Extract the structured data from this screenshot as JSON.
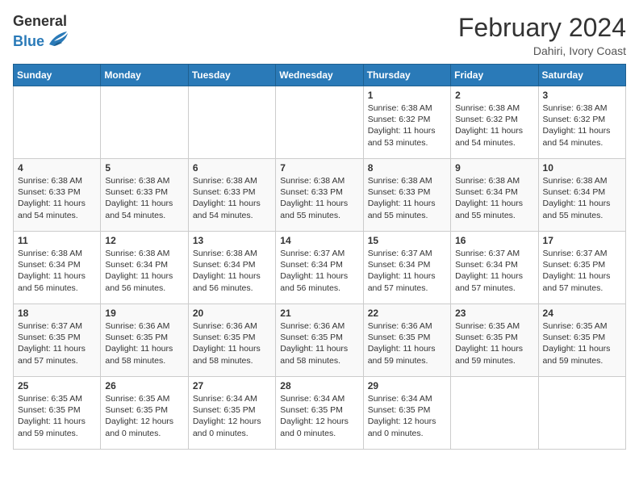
{
  "logo": {
    "general": "General",
    "blue": "Blue"
  },
  "header": {
    "month": "February 2024",
    "location": "Dahiri, Ivory Coast"
  },
  "weekdays": [
    "Sunday",
    "Monday",
    "Tuesday",
    "Wednesday",
    "Thursday",
    "Friday",
    "Saturday"
  ],
  "weeks": [
    [
      {
        "day": "",
        "info": ""
      },
      {
        "day": "",
        "info": ""
      },
      {
        "day": "",
        "info": ""
      },
      {
        "day": "",
        "info": ""
      },
      {
        "day": "1",
        "info": "Sunrise: 6:38 AM\nSunset: 6:32 PM\nDaylight: 11 hours\nand 53 minutes."
      },
      {
        "day": "2",
        "info": "Sunrise: 6:38 AM\nSunset: 6:32 PM\nDaylight: 11 hours\nand 54 minutes."
      },
      {
        "day": "3",
        "info": "Sunrise: 6:38 AM\nSunset: 6:32 PM\nDaylight: 11 hours\nand 54 minutes."
      }
    ],
    [
      {
        "day": "4",
        "info": "Sunrise: 6:38 AM\nSunset: 6:33 PM\nDaylight: 11 hours\nand 54 minutes."
      },
      {
        "day": "5",
        "info": "Sunrise: 6:38 AM\nSunset: 6:33 PM\nDaylight: 11 hours\nand 54 minutes."
      },
      {
        "day": "6",
        "info": "Sunrise: 6:38 AM\nSunset: 6:33 PM\nDaylight: 11 hours\nand 54 minutes."
      },
      {
        "day": "7",
        "info": "Sunrise: 6:38 AM\nSunset: 6:33 PM\nDaylight: 11 hours\nand 55 minutes."
      },
      {
        "day": "8",
        "info": "Sunrise: 6:38 AM\nSunset: 6:33 PM\nDaylight: 11 hours\nand 55 minutes."
      },
      {
        "day": "9",
        "info": "Sunrise: 6:38 AM\nSunset: 6:34 PM\nDaylight: 11 hours\nand 55 minutes."
      },
      {
        "day": "10",
        "info": "Sunrise: 6:38 AM\nSunset: 6:34 PM\nDaylight: 11 hours\nand 55 minutes."
      }
    ],
    [
      {
        "day": "11",
        "info": "Sunrise: 6:38 AM\nSunset: 6:34 PM\nDaylight: 11 hours\nand 56 minutes."
      },
      {
        "day": "12",
        "info": "Sunrise: 6:38 AM\nSunset: 6:34 PM\nDaylight: 11 hours\nand 56 minutes."
      },
      {
        "day": "13",
        "info": "Sunrise: 6:38 AM\nSunset: 6:34 PM\nDaylight: 11 hours\nand 56 minutes."
      },
      {
        "day": "14",
        "info": "Sunrise: 6:37 AM\nSunset: 6:34 PM\nDaylight: 11 hours\nand 56 minutes."
      },
      {
        "day": "15",
        "info": "Sunrise: 6:37 AM\nSunset: 6:34 PM\nDaylight: 11 hours\nand 57 minutes."
      },
      {
        "day": "16",
        "info": "Sunrise: 6:37 AM\nSunset: 6:34 PM\nDaylight: 11 hours\nand 57 minutes."
      },
      {
        "day": "17",
        "info": "Sunrise: 6:37 AM\nSunset: 6:35 PM\nDaylight: 11 hours\nand 57 minutes."
      }
    ],
    [
      {
        "day": "18",
        "info": "Sunrise: 6:37 AM\nSunset: 6:35 PM\nDaylight: 11 hours\nand 57 minutes."
      },
      {
        "day": "19",
        "info": "Sunrise: 6:36 AM\nSunset: 6:35 PM\nDaylight: 11 hours\nand 58 minutes."
      },
      {
        "day": "20",
        "info": "Sunrise: 6:36 AM\nSunset: 6:35 PM\nDaylight: 11 hours\nand 58 minutes."
      },
      {
        "day": "21",
        "info": "Sunrise: 6:36 AM\nSunset: 6:35 PM\nDaylight: 11 hours\nand 58 minutes."
      },
      {
        "day": "22",
        "info": "Sunrise: 6:36 AM\nSunset: 6:35 PM\nDaylight: 11 hours\nand 59 minutes."
      },
      {
        "day": "23",
        "info": "Sunrise: 6:35 AM\nSunset: 6:35 PM\nDaylight: 11 hours\nand 59 minutes."
      },
      {
        "day": "24",
        "info": "Sunrise: 6:35 AM\nSunset: 6:35 PM\nDaylight: 11 hours\nand 59 minutes."
      }
    ],
    [
      {
        "day": "25",
        "info": "Sunrise: 6:35 AM\nSunset: 6:35 PM\nDaylight: 11 hours\nand 59 minutes."
      },
      {
        "day": "26",
        "info": "Sunrise: 6:35 AM\nSunset: 6:35 PM\nDaylight: 12 hours\nand 0 minutes."
      },
      {
        "day": "27",
        "info": "Sunrise: 6:34 AM\nSunset: 6:35 PM\nDaylight: 12 hours\nand 0 minutes."
      },
      {
        "day": "28",
        "info": "Sunrise: 6:34 AM\nSunset: 6:35 PM\nDaylight: 12 hours\nand 0 minutes."
      },
      {
        "day": "29",
        "info": "Sunrise: 6:34 AM\nSunset: 6:35 PM\nDaylight: 12 hours\nand 0 minutes."
      },
      {
        "day": "",
        "info": ""
      },
      {
        "day": "",
        "info": ""
      }
    ]
  ]
}
